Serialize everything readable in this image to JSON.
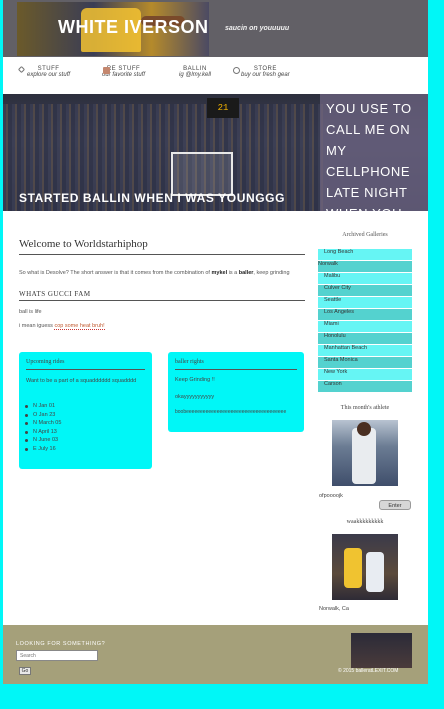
{
  "header": {
    "site_title": "WHITE IVERSON",
    "tagline": "saucin on youuuuu"
  },
  "nav": {
    "items": [
      {
        "label": "STUFF",
        "sub": "explore our stuff",
        "icon": "pencil-icon"
      },
      {
        "label": "RE STUFF",
        "sub": "our favorite stuff",
        "icon": "photo-icon"
      },
      {
        "label": "BALLIN",
        "sub": "ig @lmy.kell",
        "icon": ""
      },
      {
        "label": "STORE",
        "sub": "buy our fresh gear",
        "icon": "refresh-icon"
      }
    ]
  },
  "hero": {
    "caption": "STARTED BALLIN WHEN I WAS YOUNGGG",
    "overlay_text": "YOU USE TO CALL ME ON MY CELLPHONE LATE NIGHT WHEN YOU",
    "scoreboard": "21"
  },
  "main": {
    "title": "Welcome to Worldstarhiphop",
    "intro_pre": "So what is Desolve? The short answer is that it comes from the combination of ",
    "intro_b1": "mykel",
    "intro_mid": " is a ",
    "intro_b2": "baller",
    "intro_post": ", keep grinding",
    "section_title": "WHATS GUCCI FAM",
    "line1": "ball is life",
    "line2_pre": "i mean iguess ",
    "line2_link": "cop some heat bruh!"
  },
  "widgets": {
    "upcoming": {
      "title": "Upcoming rides",
      "text": "Want to be a part of a squadddddd squadddd",
      "items": [
        "N Jan 01",
        "O Jan 23",
        "N March 05",
        "N April 13",
        "N June 03",
        "E July 16"
      ]
    },
    "baller": {
      "title": "baller rights",
      "line1": "Keep Grinding !!",
      "line2": "okayyyyyyyyyyy",
      "line3": "boobeeeeeeeeeeeeeeeeeeeeeeeeeeeeeeeeeeee"
    }
  },
  "sidebar": {
    "archived_title": "Archived Galleries",
    "categories": [
      "Long Beach",
      "Norwalk",
      "Malibu",
      "Culver City",
      "Seattle",
      "Los Angeles",
      "Miami",
      "Honolulu",
      "Manhattan Beach",
      "Santa Monica",
      "New York",
      "Carson"
    ],
    "athlete_title": "This month's athlete",
    "athlete_caption": "ofpoooojk",
    "enter_label": "Enter",
    "second_title": "waakkkkkkkkk",
    "second_caption": "Norwalk, Ca"
  },
  "footer": {
    "search_label": "LOOKING FOR SOMETHING?",
    "search_placeholder": "Search",
    "go_label": "Go",
    "copyright": "© 2015 balleratLEXIT.COM"
  }
}
